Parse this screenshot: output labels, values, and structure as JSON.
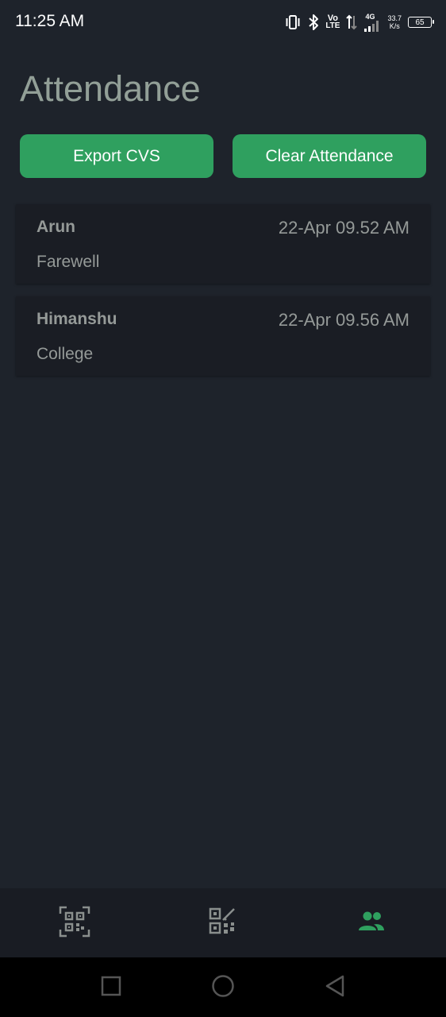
{
  "status_bar": {
    "time": "11:25 AM",
    "volte_top": "Vo",
    "volte_bottom": "LTE",
    "network_type": "4G",
    "speed_value": "33.7",
    "speed_unit": "K/s",
    "battery": "65"
  },
  "page": {
    "title": "Attendance"
  },
  "actions": {
    "export_label": "Export CVS",
    "clear_label": "Clear Attendance"
  },
  "records": [
    {
      "name": "Arun",
      "time": "22-Apr 09.52 AM",
      "event": "Farewell"
    },
    {
      "name": "Himanshu",
      "time": "22-Apr 09.56 AM",
      "event": "College"
    }
  ],
  "bottom_nav": {
    "items": [
      {
        "icon": "qr-scan-icon",
        "active": false
      },
      {
        "icon": "qr-edit-icon",
        "active": false
      },
      {
        "icon": "people-icon",
        "active": true
      }
    ],
    "active_color": "#2fa05f",
    "inactive_color": "#8a8f8d"
  },
  "colors": {
    "background": "#1e232b",
    "accent": "#2fa05f",
    "card": "#1a1d24"
  }
}
